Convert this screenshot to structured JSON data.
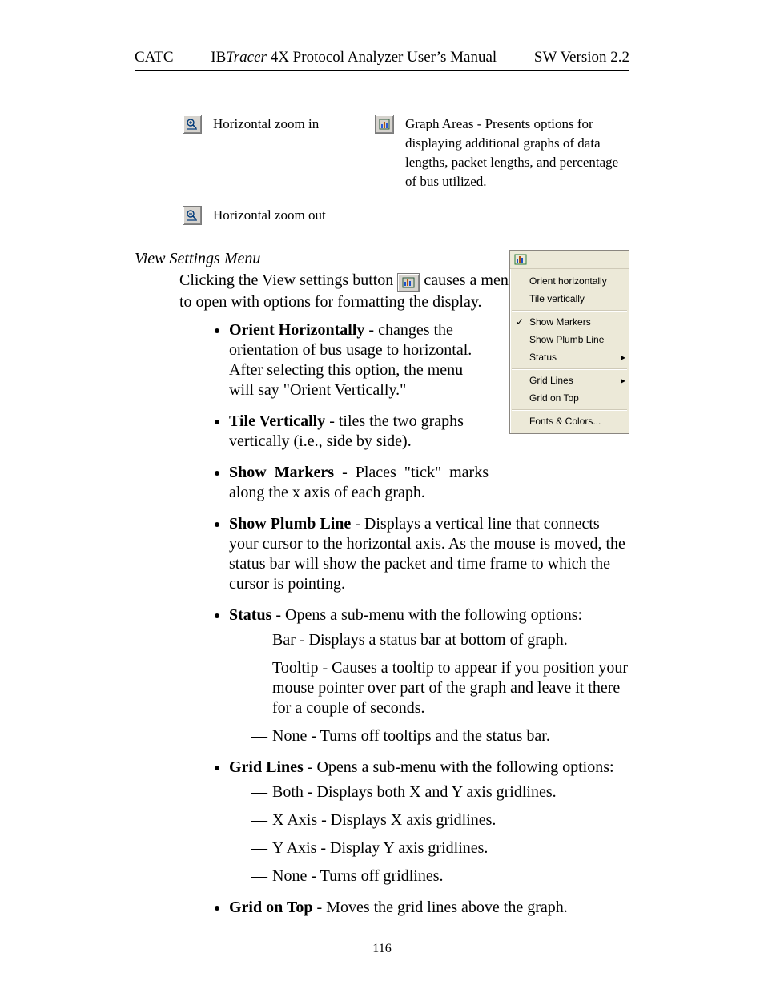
{
  "header": {
    "left": "CATC",
    "center_prefix": "IB",
    "center_em": "Tracer",
    "center_suffix": " 4X Protocol Analyzer User’s Manual",
    "right": "SW Version 2.2"
  },
  "icons_row1": {
    "zoom_in_label": "Horizontal zoom in",
    "graph_areas_label": "Graph Areas - Presents options for displaying additional graphs of data lengths, packet lengths, and percentage of bus utilized."
  },
  "row2_label": "Horizontal zoom out",
  "subheading": "View Settings Menu",
  "para_before": "Clicking the View settings button",
  "para_after_1": "causes a menu",
  "para_line2": "to open with options for formatting the display.",
  "items": {
    "i0": {
      "term": "Orient Horizontally",
      "body": " - changes the orientation of bus usage to horizontal. After selecting this option, the menu will say \"Orient Vertically.\""
    },
    "i1": {
      "term": "Tile Vertically",
      "body": " - tiles the two graphs vertically (i.e., side by side)."
    },
    "i2": {
      "term": "Show Markers",
      "body": " - Places \"tick\" marks along the x axis of each graph."
    },
    "i3": {
      "term": "Show Plumb Line",
      "body": " - Displays a vertical line that connects your cursor to the horizontal axis. As the mouse is moved, the status bar will show the packet and time frame to which the cursor is pointing."
    },
    "i4": {
      "term": "Status",
      "body": " - Opens a sub-menu with the following options:"
    },
    "i4s": {
      "s0": "Bar - Displays a status bar at bottom of graph.",
      "s1": "Tooltip - Causes a tooltip to appear if you position your mouse pointer over part of the graph and leave it there for a couple of seconds.",
      "s2": "None - Turns off tooltips and the status bar."
    },
    "i5": {
      "term": "Grid Lines",
      "body": " - Opens a sub-menu with the following options:"
    },
    "i5s": {
      "s0": "Both - Displays both X and Y axis gridlines.",
      "s1": "X Axis - Displays X axis gridlines.",
      "s2": "Y Axis - Display Y axis gridlines.",
      "s3": "None - Turns off gridlines."
    },
    "i6": {
      "term": "Grid on Top",
      "body": " - Moves the grid lines above the graph."
    }
  },
  "popup": {
    "m0": "Orient horizontally",
    "m1": "Tile vertically",
    "m2": "Show Markers",
    "m3": "Show Plumb Line",
    "m4": "Status",
    "m5": "Grid Lines",
    "m6": "Grid on Top",
    "m7": "Fonts & Colors..."
  },
  "pagenum": "116"
}
